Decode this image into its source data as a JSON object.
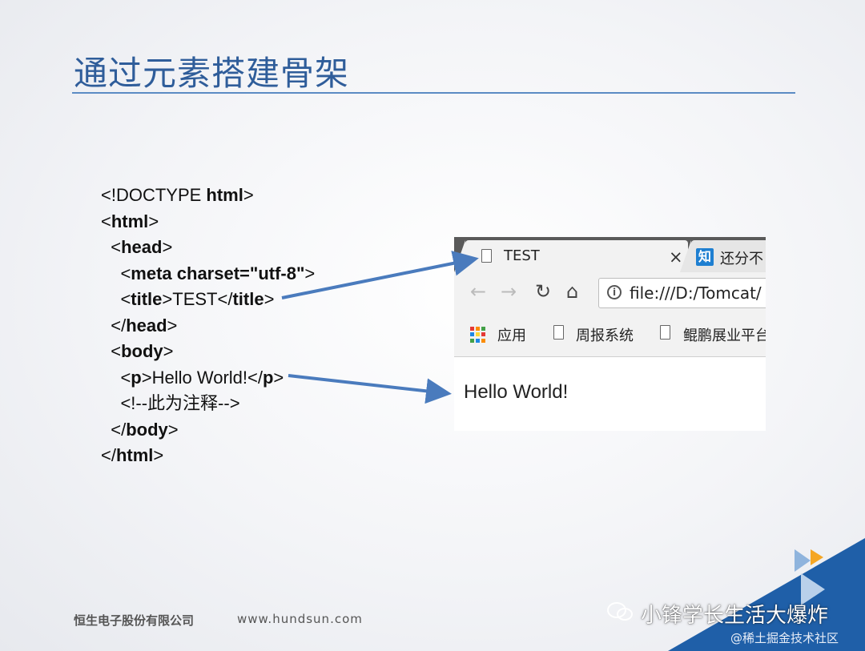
{
  "slide": {
    "title": "通过元素搭建骨架"
  },
  "code_lines": [
    {
      "parts": [
        {
          "t": "<!DOCTYPE ",
          "b": false
        },
        {
          "t": "html",
          "b": true
        },
        {
          "t": ">",
          "b": false
        }
      ]
    },
    {
      "parts": [
        {
          "t": "<",
          "b": false
        },
        {
          "t": "html",
          "b": true
        },
        {
          "t": ">",
          "b": false
        }
      ]
    },
    {
      "parts": [
        {
          "t": "  <",
          "b": false
        },
        {
          "t": "head",
          "b": true
        },
        {
          "t": ">",
          "b": false
        }
      ]
    },
    {
      "parts": [
        {
          "t": "    <",
          "b": false
        },
        {
          "t": "meta charset=\"utf-8\"",
          "b": true
        },
        {
          "t": ">",
          "b": false
        }
      ]
    },
    {
      "parts": [
        {
          "t": "    <",
          "b": false
        },
        {
          "t": "title",
          "b": true
        },
        {
          "t": ">TEST</",
          "b": false
        },
        {
          "t": "title",
          "b": true
        },
        {
          "t": ">",
          "b": false
        }
      ]
    },
    {
      "parts": [
        {
          "t": "  </",
          "b": false
        },
        {
          "t": "head",
          "b": true
        },
        {
          "t": ">",
          "b": false
        }
      ]
    },
    {
      "parts": [
        {
          "t": "  <",
          "b": false
        },
        {
          "t": "body",
          "b": true
        },
        {
          "t": ">",
          "b": false
        }
      ]
    },
    {
      "parts": [
        {
          "t": "    <",
          "b": false
        },
        {
          "t": "p",
          "b": true
        },
        {
          "t": ">Hello World!</",
          "b": false
        },
        {
          "t": "p",
          "b": true
        },
        {
          "t": ">",
          "b": false
        }
      ]
    },
    {
      "parts": [
        {
          "t": "    <!--此为注释-->",
          "b": false
        }
      ]
    },
    {
      "parts": [
        {
          "t": "  </",
          "b": false
        },
        {
          "t": "body",
          "b": true
        },
        {
          "t": ">",
          "b": false
        }
      ]
    },
    {
      "parts": [
        {
          "t": "</",
          "b": false
        },
        {
          "t": "html",
          "b": true
        },
        {
          "t": ">",
          "b": false
        }
      ]
    }
  ],
  "browser": {
    "active_tab": {
      "title": "TEST",
      "close": "×",
      "icon": "document-icon"
    },
    "second_tab": {
      "title": "还分不",
      "icon_text": "知"
    },
    "toolbar": {
      "back": "←",
      "forward": "→",
      "reload": "↻",
      "home": "⌂",
      "info": "i",
      "url": "file:///D:/Tomcat/"
    },
    "bookmarks": [
      {
        "label": "应用",
        "icon": "apps-grid-icon"
      },
      {
        "label": "周报系统",
        "icon": "document-icon"
      },
      {
        "label": "鲲鹏展业平台",
        "icon": "document-icon"
      }
    ],
    "page_text": "Hello World!"
  },
  "apps_colors": [
    "#e53935",
    "#fb8c00",
    "#43a047",
    "#1e88e5",
    "#fdd835",
    "#e53935",
    "#43a047",
    "#1e88e5",
    "#fb8c00"
  ],
  "footer": {
    "company": "恒生电子股份有限公司",
    "url": "www.hundsun.com"
  },
  "watermark": {
    "main": "小锋学长生活大爆炸",
    "sub": "@稀土掘金技术社区"
  },
  "colors": {
    "title": "#2f5d9a",
    "arrow": "#4a7bbd",
    "corner": "#1f5fa8",
    "accent_orange": "#f5a623"
  }
}
